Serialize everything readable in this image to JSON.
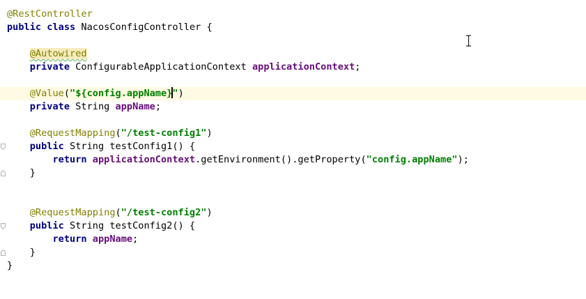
{
  "editor": {
    "lines": {
      "l1": {
        "annotation": "@RestController"
      },
      "l2": {
        "kw1": "public",
        "kw2": "class",
        "name": "NacosConfigController",
        "brace": "{"
      },
      "l4": {
        "annotation": "@Autowired"
      },
      "l5": {
        "kw": "private",
        "type": "ConfigurableApplicationContext",
        "field": "applicationContext",
        "end": ";"
      },
      "l7": {
        "annotation": "@Value",
        "open": "(",
        "str_a": "\"${config.appName}",
        "str_b": "\"",
        "close": ")"
      },
      "l8": {
        "kw": "private",
        "type": "String",
        "field": "appName",
        "end": ";"
      },
      "l10": {
        "annotation": "@RequestMapping",
        "open": "(",
        "str": "\"/test-config1\"",
        "close": ")"
      },
      "l11": {
        "kw": "public",
        "type": "String",
        "method": "testConfig1",
        "rest": "() {"
      },
      "l12": {
        "kw": "return",
        "field": "applicationContext",
        "mid": ".getEnvironment().getProperty(",
        "str": "\"config.appName\"",
        "end": ");"
      },
      "l13": {
        "brace": "}"
      },
      "l16": {
        "annotation": "@RequestMapping",
        "open": "(",
        "str": "\"/test-config2\"",
        "close": ")"
      },
      "l17": {
        "kw": "public",
        "type": "String",
        "method": "testConfig2",
        "rest": "() {"
      },
      "l18": {
        "kw": "return",
        "field": "appName",
        "end": ";"
      },
      "l19": {
        "brace": "}"
      },
      "l20": {
        "brace": "}"
      }
    }
  },
  "colors": {
    "keyword": "#000080",
    "annotation": "#808000",
    "string": "#008000",
    "field": "#660e7a",
    "current_line": "#fffae3"
  },
  "icons": [
    "fold-marker-icon",
    "text-cursor-icon"
  ]
}
